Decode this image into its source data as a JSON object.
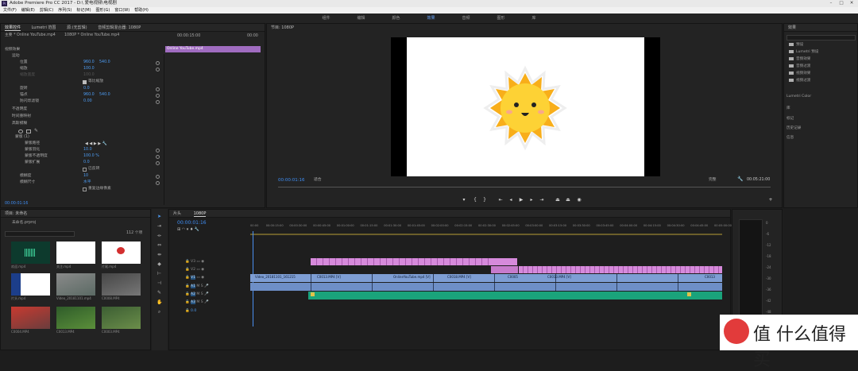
{
  "window": {
    "title": "Adobe Premiere Pro CC 2017 - D:\\ 爱电视频\\电视剧"
  },
  "menu": [
    "文件(F)",
    "编辑(E)",
    "剪辑(C)",
    "序列(S)",
    "标记(M)",
    "图形(G)",
    "窗口(W)",
    "帮助(H)"
  ],
  "workspaces": [
    "组件",
    "编辑",
    "颜色",
    "效果",
    "音频",
    "图形",
    "库"
  ],
  "effect_controls": {
    "tabs": [
      "效果控件",
      "Lumetri 范围",
      "源:(无剪辑)",
      "音频剪辑混合器: 1080P"
    ],
    "source_label": "主要 * Online YouTube.mp4",
    "seq_label": "1080P * Online YouTube.mp4",
    "clip_label": "Online YouTube.mp4",
    "ruler_start": "00:00:15:00",
    "ruler_end": "00:00",
    "section_video": "视频效果",
    "motion": "运动",
    "position": "位置",
    "position_x": "960.0",
    "position_y": "540.0",
    "scale": "缩放",
    "scale_val": "100.0",
    "scale_width": "缩放宽度",
    "scale_width_val": "100.0",
    "uniform": "等比缩放",
    "rotation": "旋转",
    "rotation_val": "0.0",
    "anchor": "锚点",
    "anchor_x": "960.0",
    "anchor_y": "540.0",
    "flicker": "防闪烁滤镜",
    "flicker_val": "0.00",
    "opacity": "不透明度",
    "time_remap": "时间重映射",
    "blur": "高斯模糊",
    "mask": "蒙版 (1)",
    "mask_path": "蒙版路径",
    "mask_feather": "蒙版羽化",
    "mask_feather_val": "10.0",
    "mask_opacity": "蒙版不透明度",
    "mask_opacity_val": "100.0 %",
    "mask_expand": "蒙版扩展",
    "mask_expand_val": "0.0",
    "inverted": "已反转",
    "blurriness": "模糊度",
    "blurriness_val": "10",
    "blur_dim": "模糊尺寸",
    "blur_dim_val": "水平",
    "repeat_edge": "重复边缘像素",
    "timecode": "00:00:01:16"
  },
  "program": {
    "title": "节目: 1080P",
    "timecode": "00:00:01:16",
    "fit": "适合",
    "quality": "完整",
    "duration": "00:05:21:00"
  },
  "effects": {
    "title": "效果",
    "items": [
      "预设",
      "Lumetri 预设",
      "音频效果",
      "音频过渡",
      "视频效果",
      "视频过渡"
    ],
    "sections": [
      "Lumetri Color",
      "库",
      "标记",
      "历史记录",
      "信息"
    ]
  },
  "project": {
    "title": "项目: 未命名",
    "file": "未命名.prproj",
    "count": "112 个项",
    "items": [
      {
        "name": "欢迎.mp4",
        "dur": ""
      },
      {
        "name": "关注.mp4",
        "dur": ""
      },
      {
        "name": "片尾.mp4",
        "dur": ""
      },
      {
        "name": "片头.mp4",
        "dur": ""
      },
      {
        "name": "Video_20181101.mp4",
        "dur": ""
      },
      {
        "name": "C0008.MP4",
        "dur": ""
      },
      {
        "name": "C0004.MP4",
        "dur": ""
      },
      {
        "name": "C0013.MP4",
        "dur": ""
      },
      {
        "name": "C0003.MP4",
        "dur": ""
      },
      {
        "name": "C0005.MP4",
        "dur": ""
      },
      {
        "name": "C0010.MP4",
        "dur": ""
      },
      {
        "name": "C0002.MP4",
        "dur": ""
      }
    ]
  },
  "timeline": {
    "tabs": [
      "片头",
      "1080P"
    ],
    "timecode": "00:00:01:16",
    "ruler": [
      "00:00",
      "00:00:15:00",
      "00:00:30:00",
      "00:00:45:00",
      "00:01:00:00",
      "00:01:15:00",
      "00:01:30:00",
      "00:01:45:00",
      "00:02:00:00",
      "00:02:15:00",
      "00:02:30:00",
      "00:02:45:00",
      "00:03:00:00",
      "00:03:15:00",
      "00:03:30:00",
      "00:03:45:00",
      "00:04:00:00",
      "00:04:15:00",
      "00:04:30:00",
      "00:04:45:00",
      "00:05:00:00"
    ],
    "tracks": [
      "V3",
      "V2",
      "V1",
      "A1",
      "A2",
      "A3"
    ],
    "master_val": "0.0",
    "clips_v1": [
      "Video_20181101_161215",
      "C0013.MP4 [V]",
      "OnlineYouTube.mp4 [V]",
      "C0018.MP4 [V]",
      "C0005",
      "C0013.MP4 [V]",
      "C0013"
    ]
  },
  "meter": {
    "scale": [
      "0",
      "-6",
      "-12",
      "-18",
      "-24",
      "-30",
      "-36",
      "-42",
      "-48",
      "-54"
    ]
  },
  "watermark": "值 什么值得买"
}
